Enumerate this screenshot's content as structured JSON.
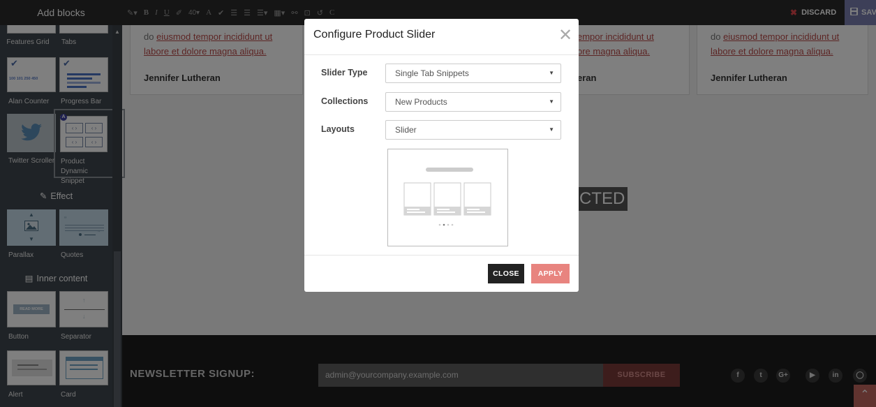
{
  "topbar": {
    "sidebar_title": "Add blocks",
    "tools": [
      "✎▾",
      "B",
      "I",
      "U",
      "✐",
      "40▾",
      "A",
      "✔",
      "☰",
      "☰",
      "☰▾",
      "▦▾",
      "⚯",
      "⊡",
      "↺",
      "C"
    ],
    "discard_label": "DISCARD",
    "save_label": "SAVE"
  },
  "sidebar": {
    "blocks": {
      "features_grid": "Features Grid",
      "tabs": "Tabs",
      "alan_counter": "Alan Counter",
      "progress_bar": "Progress Bar",
      "twitter_scroller": "Twitter Scroller",
      "product_dynamic_snippet": "Product Dynamic Snippet",
      "parallax": "Parallax",
      "quotes": "Quotes",
      "button": "Button",
      "separator": "Separator",
      "alert": "Alert",
      "card": "Card"
    },
    "counter_nums": "100  101  250  450",
    "read_more": "READ MORE",
    "selected_badge": "A",
    "sections": {
      "effect": "Effect",
      "inner_content": "Inner content"
    }
  },
  "page": {
    "testimonials": [
      {
        "line1_prefix": "do ",
        "line1_u": "eiusmod tempor incididunt ut",
        "line2_u": "labore et dolore magna aliqua.",
        "author": "Jennifer Lutheran"
      },
      {
        "line1_u": "empor incididunt ut",
        "line2_u": "ore magna aliqua.",
        "author": "eran"
      },
      {
        "line1_prefix": "do ",
        "line1_u": "eiusmod tempor incididunt ut",
        "line2_u": "labore et dolore magna aliqua.",
        "author": "Jennifer Lutheran"
      }
    ],
    "banner_text": "CTED",
    "newsletter": {
      "label": "NEWSLETTER SIGNUP:",
      "email_value": "admin@yourcompany.example.com",
      "subscribe": "SUBSCRIBE"
    },
    "social": [
      "f",
      "t",
      "G+",
      "▶",
      "in",
      "◯"
    ]
  },
  "modal": {
    "title": "Configure Product Slider",
    "close_glyph": "✕",
    "fields": [
      {
        "label": "Slider Type",
        "value": "Single Tab Snippets"
      },
      {
        "label": "Collections",
        "value": "New Products"
      },
      {
        "label": "Layouts",
        "value": "Slider"
      }
    ],
    "close_button": "CLOSE",
    "apply_button": "APPLY"
  },
  "colors": {
    "topbar": "#2b2b2b",
    "sidebar": "#3f474e",
    "accent_save": "#7b7fb0",
    "apply": "#e8847f",
    "discard_x": "#e0474c"
  }
}
